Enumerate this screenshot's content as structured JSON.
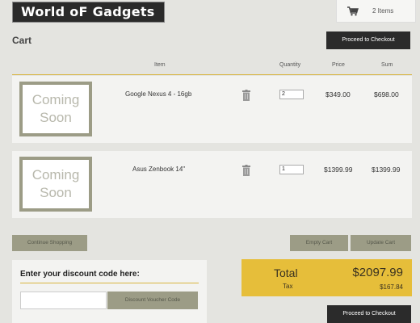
{
  "header": {
    "logo": "World oF Gadgets",
    "cart_count": "2 Items"
  },
  "cart": {
    "title": "Cart",
    "checkout_label": "Proceed to Checkout",
    "columns": {
      "item": "Item",
      "quantity": "Quantity",
      "price": "Price",
      "sum": "Sum"
    },
    "items": [
      {
        "image_line1": "Coming",
        "image_line2": "Soon",
        "name": "Google Nexus 4 - 16gb",
        "quantity": "2",
        "price": "$349.00",
        "sum": "$698.00"
      },
      {
        "image_line1": "Coming",
        "image_line2": "Soon",
        "name": "Asus Zenbook 14\"",
        "quantity": "1",
        "price": "$1399.99",
        "sum": "$1399.99"
      }
    ],
    "continue_label": "Continue Shopping",
    "empty_label": "Empty Cart",
    "update_label": "Update Cart"
  },
  "discount": {
    "heading": "Enter your discount code here:",
    "code_value": "",
    "button_label": "Discount Voucher Code"
  },
  "totals": {
    "total_label": "Total",
    "total_value": "$2097.99",
    "tax_label": "Tax",
    "tax_value": "$167.84"
  },
  "colors": {
    "accent": "#e6be3a",
    "button_dark": "#2b2b2b",
    "button_grey": "#9c9c86",
    "background": "#e4e4e0"
  }
}
